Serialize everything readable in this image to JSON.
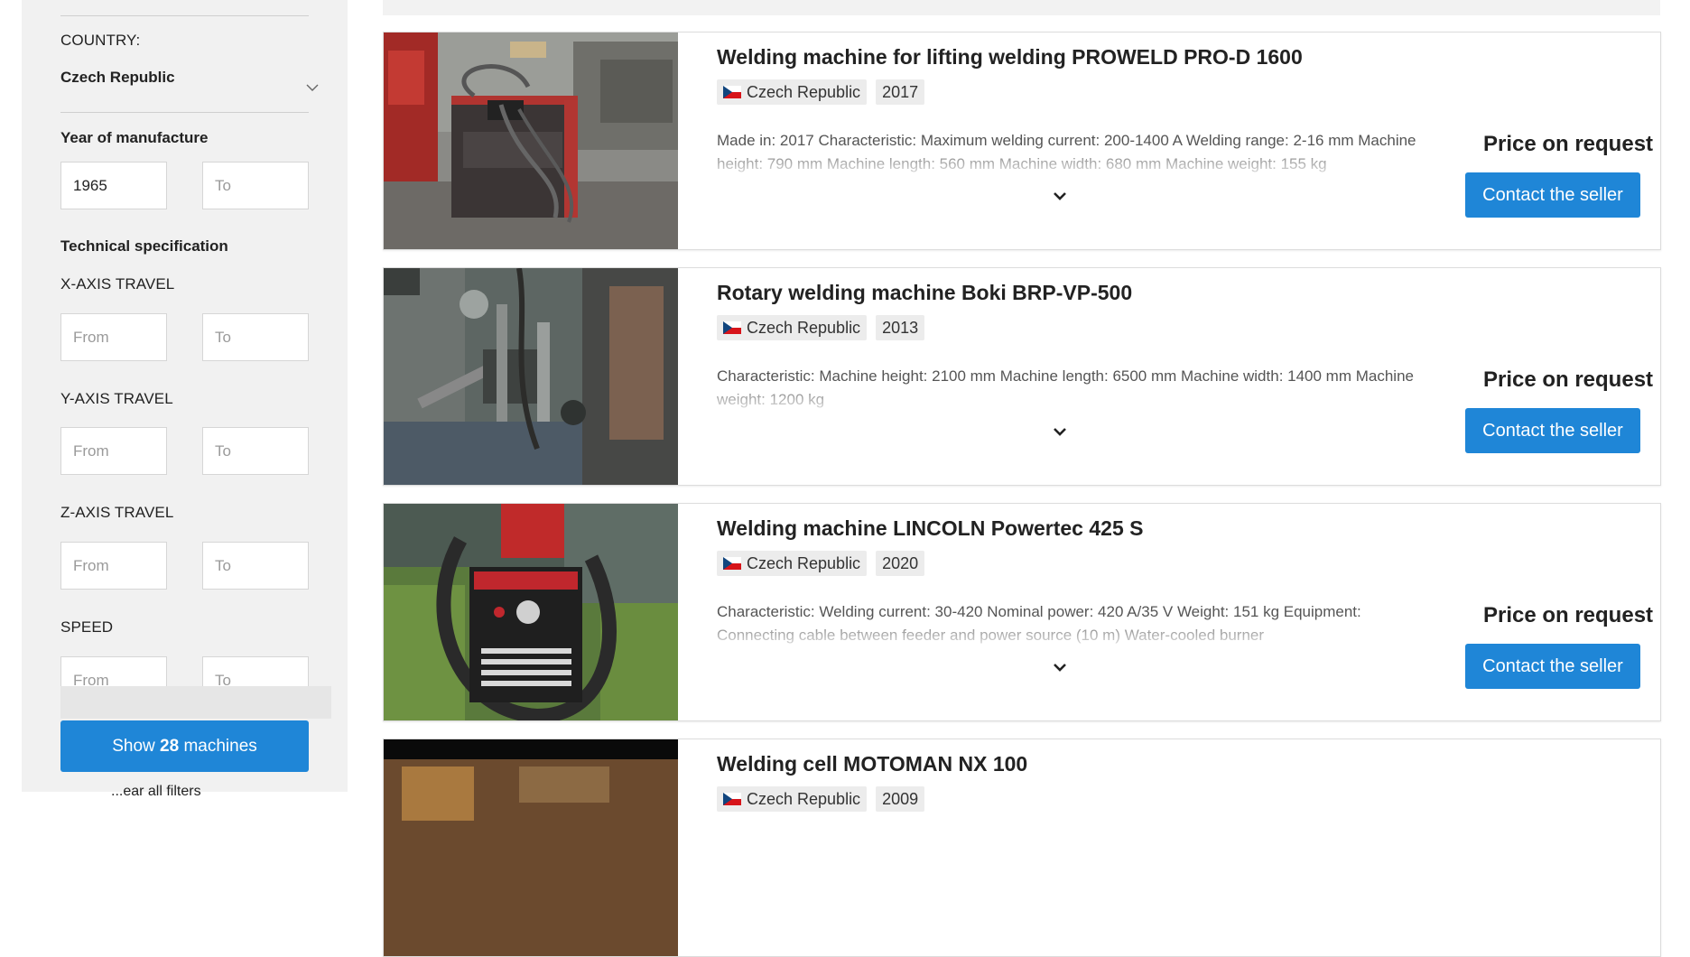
{
  "filters": {
    "country_label": "COUNTRY:",
    "country_value": "Czech Republic",
    "year_label": "Year of manufacture",
    "year_from_value": "1965",
    "year_to_placeholder": "To",
    "tech_spec_label": "Technical specification",
    "x_axis_label": "X-AXIS TRAVEL",
    "y_axis_label": "Y-AXIS TRAVEL",
    "z_axis_label": "Z-AXIS TRAVEL",
    "speed_label": "SPEED",
    "from_placeholder": "From",
    "to_placeholder": "To",
    "show_button_prefix": "Show",
    "show_count": "28",
    "show_button_suffix": "machines",
    "clear_label": "...ear all filters"
  },
  "listings": [
    {
      "title": "Welding machine for lifting welding PROWELD PRO-D 1600",
      "country": "Czech Republic",
      "year": "2017",
      "description": "Made in: 2017 Characteristic: Maximum welding current: 200-1400 A Welding range: 2-16 mm Machine height: 790 mm Machine length: 560 mm Machine width: 680 mm Machine weight: 155 kg",
      "price": "Price on request",
      "contact_label": "Contact the seller"
    },
    {
      "title": "Rotary welding machine Boki BRP-VP-500",
      "country": "Czech Republic",
      "year": "2013",
      "description": "Characteristic: Machine height: 2100 mm Machine length: 6500 mm Machine width: 1400 mm Machine weight: 1200 kg",
      "price": "Price on request",
      "contact_label": "Contact the seller"
    },
    {
      "title": "Welding machine LINCOLN Powertec 425 S",
      "country": "Czech Republic",
      "year": "2020",
      "description": "Characteristic: Welding current: 30-420 Nominal power: 420 A/35 V Weight: 151 kg Equipment: Connecting cable between feeder and power source (10 m) Water-cooled burner",
      "price": "Price on request",
      "contact_label": "Contact the seller"
    },
    {
      "title": "Welding cell MOTOMAN NX 100",
      "country": "Czech Republic",
      "year": "2009"
    }
  ],
  "icons": {
    "dropdown": "chevron-down-icon",
    "expand": "chevron-down-icon",
    "flag": "czech-flag-icon"
  },
  "colors": {
    "accent": "#1f86d7",
    "sidebar_bg": "#f1f1f1",
    "tag_bg": "#ececec"
  }
}
